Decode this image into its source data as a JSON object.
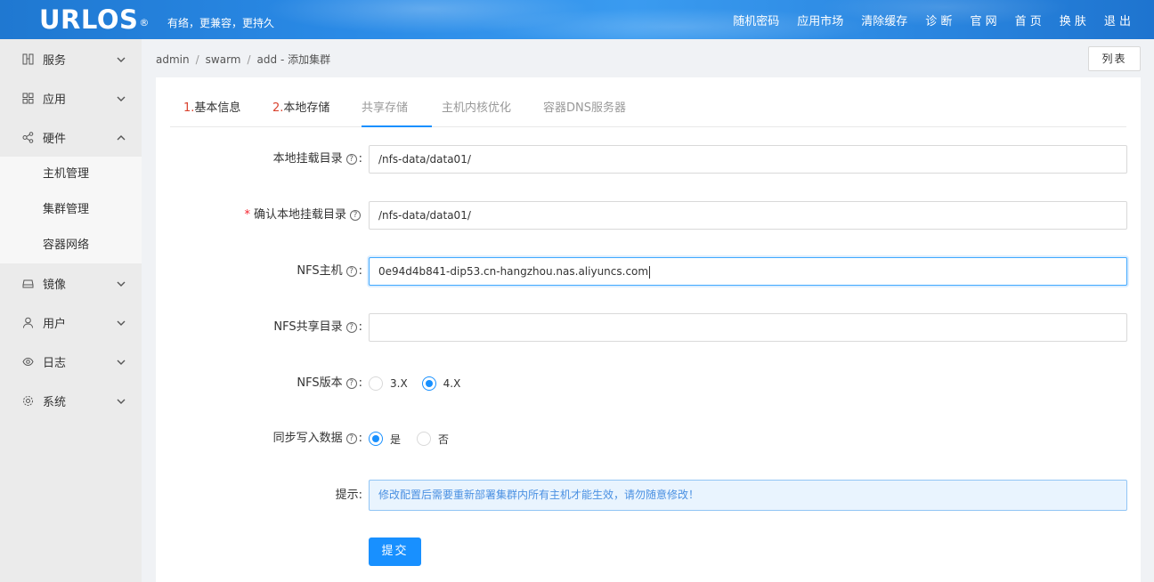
{
  "header": {
    "logo": "URLOS",
    "logo_mark": "®",
    "slogan": "有络，更兼容，更持久",
    "nav": [
      "随机密码",
      "应用市场",
      "清除缓存",
      "诊 断",
      "官 网",
      "首 页",
      "换 肤",
      "退 出"
    ]
  },
  "sidebar": {
    "items": [
      {
        "label": "服务",
        "icon": "grid-icon",
        "expanded": false
      },
      {
        "label": "应用",
        "icon": "apps-icon",
        "expanded": false
      },
      {
        "label": "硬件",
        "icon": "share-icon",
        "expanded": true
      },
      {
        "label": "镜像",
        "icon": "drive-icon",
        "expanded": false
      },
      {
        "label": "用户",
        "icon": "user-icon",
        "expanded": false
      },
      {
        "label": "日志",
        "icon": "eye-icon",
        "expanded": false
      },
      {
        "label": "系统",
        "icon": "gear-icon",
        "expanded": false
      }
    ],
    "submenu": [
      "主机管理",
      "集群管理",
      "容器网络"
    ]
  },
  "breadcrumb": {
    "parts": [
      "admin",
      "swarm",
      "add"
    ],
    "title": "添加集群"
  },
  "list_button": "列表",
  "tabs": [
    {
      "num": "1.",
      "label": "基本信息"
    },
    {
      "num": "2.",
      "label": "本地存储"
    },
    {
      "num": "",
      "label": "共享存储"
    },
    {
      "num": "",
      "label": "主机内核优化"
    },
    {
      "num": "",
      "label": "容器DNS服务器"
    }
  ],
  "form": {
    "local_mount": {
      "label": "本地挂载目录",
      "value": "/nfs-data/data01/"
    },
    "confirm_mount": {
      "label": "确认本地挂载目录",
      "value": "/nfs-data/data01/"
    },
    "nfs_host": {
      "label": "NFS主机",
      "value": "0e94d4b841-dip53.cn-hangzhou.nas.aliyuncs.com"
    },
    "nfs_dir": {
      "label": "NFS共享目录",
      "value": ""
    },
    "nfs_version": {
      "label": "NFS版本",
      "options": [
        "3.X",
        "4.X"
      ],
      "selected": "4.X"
    },
    "sync_write": {
      "label": "同步写入数据",
      "options": [
        "是",
        "否"
      ],
      "selected": "是"
    },
    "tip": {
      "label": "提示",
      "text": "修改配置后需要重新部署集群内所有主机才能生效，请勿随意修改！"
    },
    "submit": "提交"
  },
  "colors": {
    "primary": "#1890ff",
    "header": "#2a8ae6",
    "required": "#f5222d",
    "tab_num": "#d9432f"
  }
}
